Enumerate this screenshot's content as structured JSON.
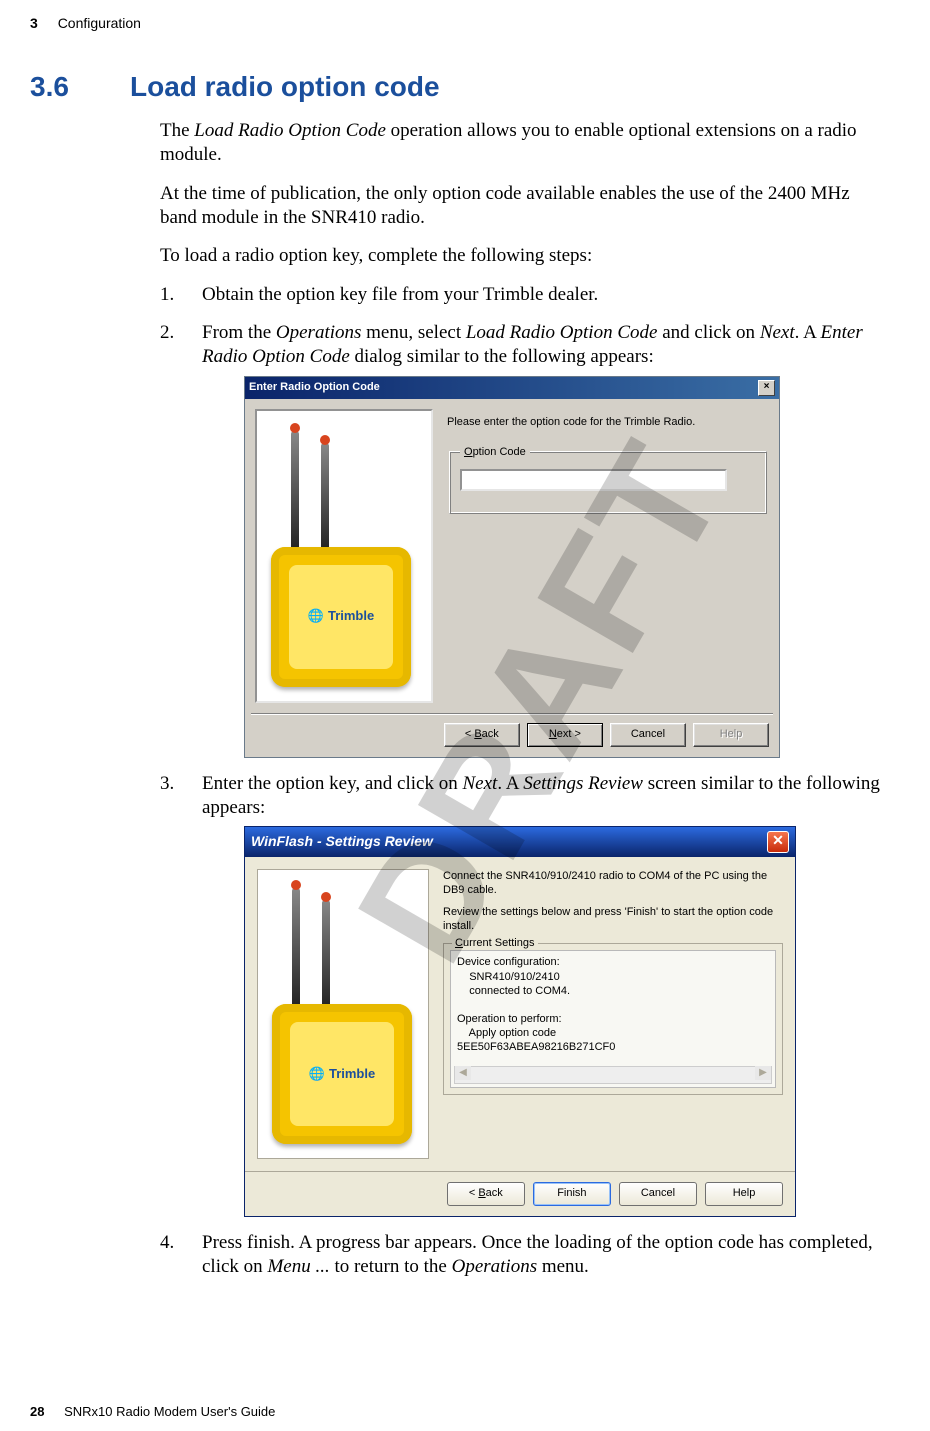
{
  "header": {
    "chapter_number": "3",
    "chapter_label": "Configuration"
  },
  "section": {
    "number": "3.6",
    "title": "Load radio option code"
  },
  "body": {
    "p1a": "The ",
    "p1b": "Load Radio Option Code",
    "p1c": " operation allows you to enable optional extensions on a radio module.",
    "p2": "At the time of publication, the only option code available enables the use of the 2400 MHz band module in the SNR410 radio.",
    "p3": "To load a radio option key, complete the following steps:"
  },
  "steps": {
    "s1": {
      "num": "1.",
      "text": "Obtain the option key file from your Trimble dealer."
    },
    "s2": {
      "num": "2.",
      "t1": "From the ",
      "t2": "Operations",
      "t3": " menu, select ",
      "t4": "Load Radio Option Code",
      "t5": " and click on ",
      "t6": "Next",
      "t7": ". A ",
      "t8": "Enter Radio Option Code",
      "t9": " dialog similar to the following appears:"
    },
    "s3": {
      "num": "3.",
      "t1": "Enter the option key, and click on ",
      "t2": "Next",
      "t3": ". A ",
      "t4": "Settings Review",
      "t5": " screen similar to the following appears:"
    },
    "s4": {
      "num": "4.",
      "t1": "Press finish. A progress bar appears. Once the loading of the option code has completed, click on ",
      "t2": "Menu ...",
      "t3": " to return to the ",
      "t4": "Operations",
      "t5": " menu."
    }
  },
  "dialog1": {
    "title": "Enter Radio Option Code",
    "instruction": "Please enter the option code for the Trimble Radio.",
    "fieldset_legend": "Option Code",
    "input_value": "",
    "device_brand": "Trimble",
    "buttons": {
      "back": "< Back",
      "next": "Next >",
      "cancel": "Cancel",
      "help": "Help"
    }
  },
  "dialog2": {
    "title": "WinFlash - Settings Review",
    "instruction1": "Connect the SNR410/910/2410 radio to COM4 of the PC using the DB9 cable.",
    "instruction2": "Review the settings below and press 'Finish' to start the option code install.",
    "fieldset_legend": "Current Settings",
    "settings_text": "Device configuration:\n    SNR410/910/2410\n    connected to COM4.\n\nOperation to perform:\n    Apply option code\n5EE50F63ABEA98216B271CF0",
    "device_brand": "Trimble",
    "buttons": {
      "back": "< Back",
      "finish": "Finish",
      "cancel": "Cancel",
      "help": "Help"
    }
  },
  "watermark": "DRAFT",
  "footer": {
    "page_number": "28",
    "book_title": "SNRx10 Radio Modem User's Guide"
  }
}
